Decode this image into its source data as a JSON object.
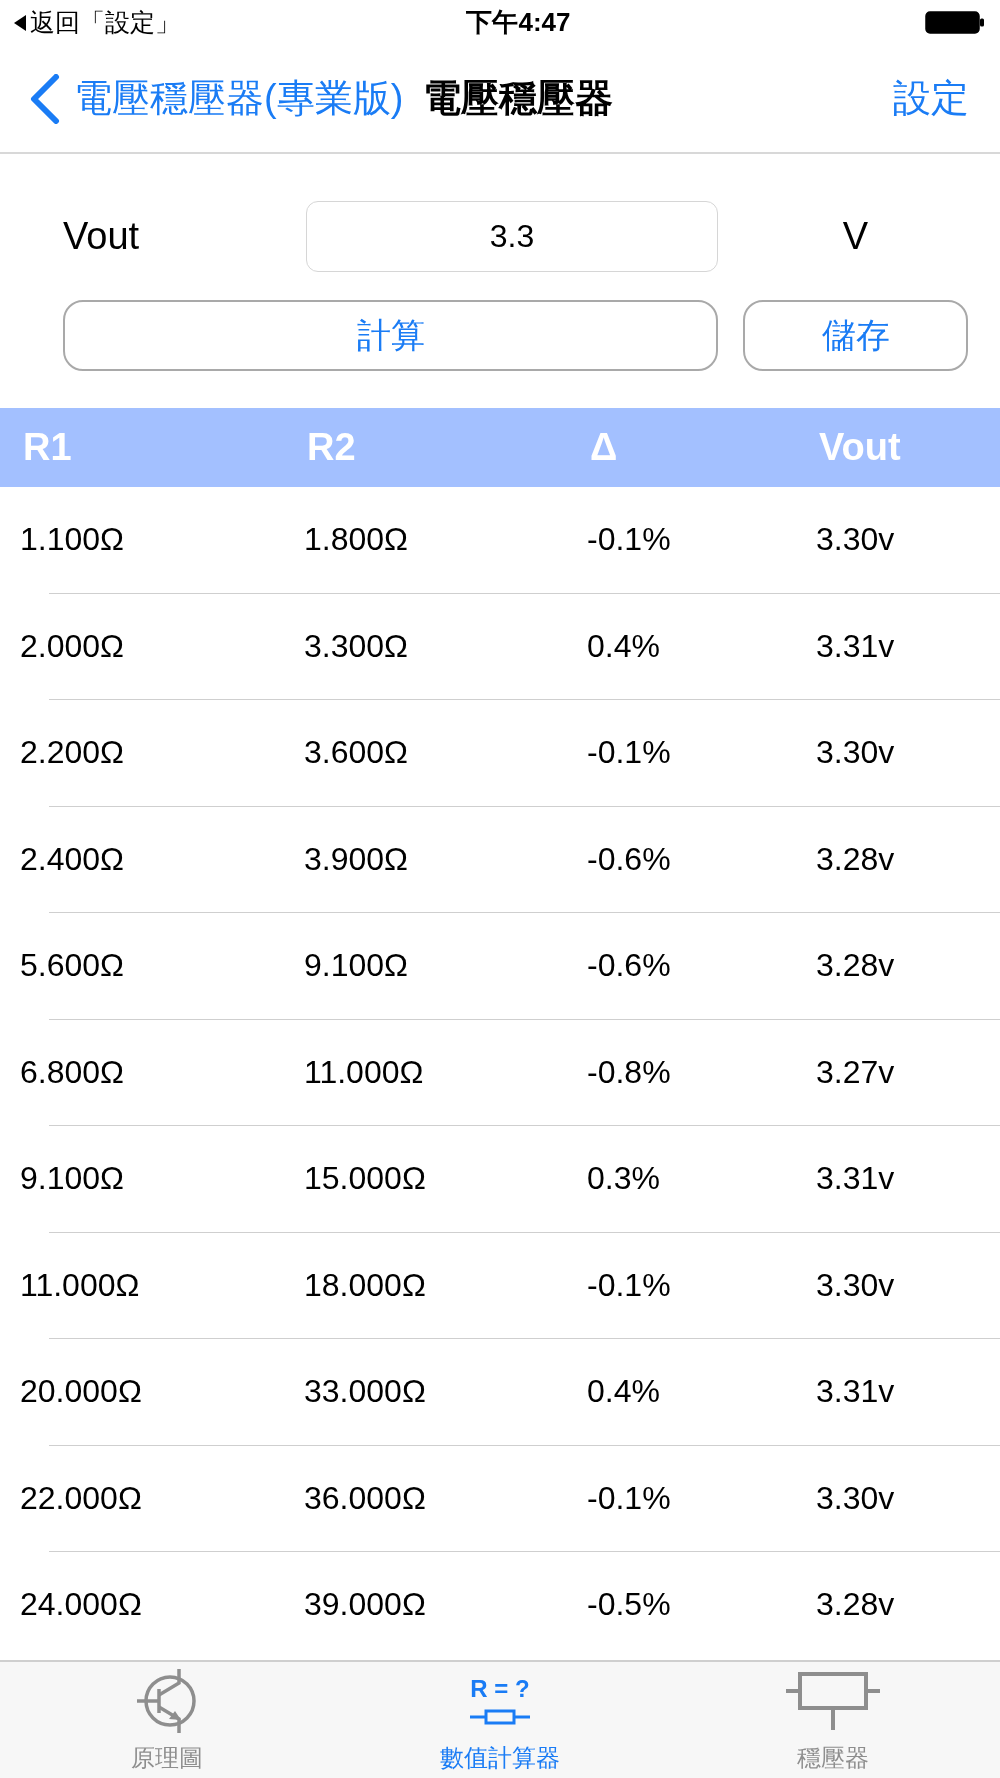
{
  "status_bar": {
    "back_label": "返回「設定」",
    "time": "下午4:47"
  },
  "nav_bar": {
    "back_label": "電壓穩壓器(專業版)",
    "title": "電壓穩壓器",
    "right_button": "設定"
  },
  "form": {
    "label": "Vout",
    "value": "3.3",
    "unit": "V",
    "buttons": [
      "計算",
      "儲存"
    ]
  },
  "table": {
    "columns": [
      "R1",
      "R2",
      "Δ",
      "Vout"
    ],
    "rows": [
      [
        "1.100Ω",
        "1.800Ω",
        "-0.1%",
        "3.30v"
      ],
      [
        "2.000Ω",
        "3.300Ω",
        "0.4%",
        "3.31v"
      ],
      [
        "2.200Ω",
        "3.600Ω",
        "-0.1%",
        "3.30v"
      ],
      [
        "2.400Ω",
        "3.900Ω",
        "-0.6%",
        "3.28v"
      ],
      [
        "5.600Ω",
        "9.100Ω",
        "-0.6%",
        "3.28v"
      ],
      [
        "6.800Ω",
        "11.000Ω",
        "-0.8%",
        "3.27v"
      ],
      [
        "9.100Ω",
        "15.000Ω",
        "0.3%",
        "3.31v"
      ],
      [
        "11.000Ω",
        "18.000Ω",
        "-0.1%",
        "3.30v"
      ],
      [
        "20.000Ω",
        "33.000Ω",
        "0.4%",
        "3.31v"
      ],
      [
        "22.000Ω",
        "36.000Ω",
        "-0.1%",
        "3.30v"
      ],
      [
        "24.000Ω",
        "39.000Ω",
        "-0.5%",
        "3.28v"
      ]
    ]
  },
  "tab_bar": {
    "items": [
      {
        "label": "原理圖",
        "kind": "transistor",
        "selected": false
      },
      {
        "label": "數值計算器",
        "kind": "calculator",
        "icon_text": "R = ?",
        "selected": true
      },
      {
        "label": "穩壓器",
        "kind": "regulator",
        "selected": false
      }
    ]
  }
}
